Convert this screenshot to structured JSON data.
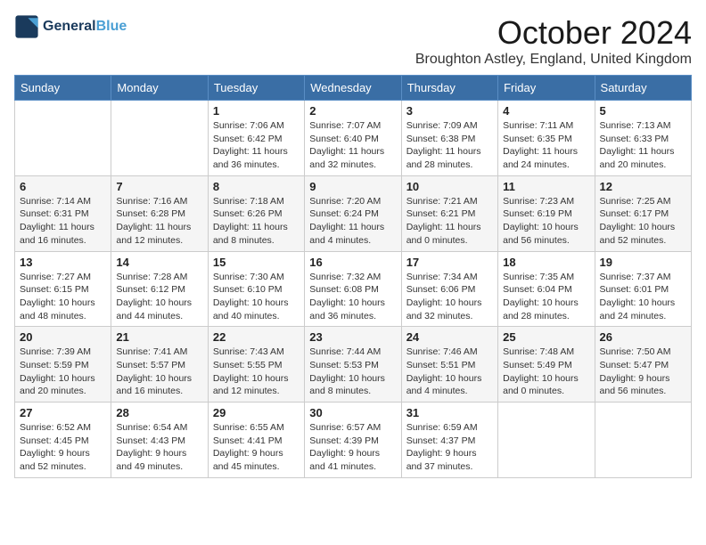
{
  "logo": {
    "line1": "General",
    "line2": "Blue"
  },
  "title": "October 2024",
  "location": "Broughton Astley, England, United Kingdom",
  "days_header": [
    "Sunday",
    "Monday",
    "Tuesday",
    "Wednesday",
    "Thursday",
    "Friday",
    "Saturday"
  ],
  "weeks": [
    [
      {
        "day": "",
        "info": ""
      },
      {
        "day": "",
        "info": ""
      },
      {
        "day": "1",
        "info": "Sunrise: 7:06 AM\nSunset: 6:42 PM\nDaylight: 11 hours and 36 minutes."
      },
      {
        "day": "2",
        "info": "Sunrise: 7:07 AM\nSunset: 6:40 PM\nDaylight: 11 hours and 32 minutes."
      },
      {
        "day": "3",
        "info": "Sunrise: 7:09 AM\nSunset: 6:38 PM\nDaylight: 11 hours and 28 minutes."
      },
      {
        "day": "4",
        "info": "Sunrise: 7:11 AM\nSunset: 6:35 PM\nDaylight: 11 hours and 24 minutes."
      },
      {
        "day": "5",
        "info": "Sunrise: 7:13 AM\nSunset: 6:33 PM\nDaylight: 11 hours and 20 minutes."
      }
    ],
    [
      {
        "day": "6",
        "info": "Sunrise: 7:14 AM\nSunset: 6:31 PM\nDaylight: 11 hours and 16 minutes."
      },
      {
        "day": "7",
        "info": "Sunrise: 7:16 AM\nSunset: 6:28 PM\nDaylight: 11 hours and 12 minutes."
      },
      {
        "day": "8",
        "info": "Sunrise: 7:18 AM\nSunset: 6:26 PM\nDaylight: 11 hours and 8 minutes."
      },
      {
        "day": "9",
        "info": "Sunrise: 7:20 AM\nSunset: 6:24 PM\nDaylight: 11 hours and 4 minutes."
      },
      {
        "day": "10",
        "info": "Sunrise: 7:21 AM\nSunset: 6:21 PM\nDaylight: 11 hours and 0 minutes."
      },
      {
        "day": "11",
        "info": "Sunrise: 7:23 AM\nSunset: 6:19 PM\nDaylight: 10 hours and 56 minutes."
      },
      {
        "day": "12",
        "info": "Sunrise: 7:25 AM\nSunset: 6:17 PM\nDaylight: 10 hours and 52 minutes."
      }
    ],
    [
      {
        "day": "13",
        "info": "Sunrise: 7:27 AM\nSunset: 6:15 PM\nDaylight: 10 hours and 48 minutes."
      },
      {
        "day": "14",
        "info": "Sunrise: 7:28 AM\nSunset: 6:12 PM\nDaylight: 10 hours and 44 minutes."
      },
      {
        "day": "15",
        "info": "Sunrise: 7:30 AM\nSunset: 6:10 PM\nDaylight: 10 hours and 40 minutes."
      },
      {
        "day": "16",
        "info": "Sunrise: 7:32 AM\nSunset: 6:08 PM\nDaylight: 10 hours and 36 minutes."
      },
      {
        "day": "17",
        "info": "Sunrise: 7:34 AM\nSunset: 6:06 PM\nDaylight: 10 hours and 32 minutes."
      },
      {
        "day": "18",
        "info": "Sunrise: 7:35 AM\nSunset: 6:04 PM\nDaylight: 10 hours and 28 minutes."
      },
      {
        "day": "19",
        "info": "Sunrise: 7:37 AM\nSunset: 6:01 PM\nDaylight: 10 hours and 24 minutes."
      }
    ],
    [
      {
        "day": "20",
        "info": "Sunrise: 7:39 AM\nSunset: 5:59 PM\nDaylight: 10 hours and 20 minutes."
      },
      {
        "day": "21",
        "info": "Sunrise: 7:41 AM\nSunset: 5:57 PM\nDaylight: 10 hours and 16 minutes."
      },
      {
        "day": "22",
        "info": "Sunrise: 7:43 AM\nSunset: 5:55 PM\nDaylight: 10 hours and 12 minutes."
      },
      {
        "day": "23",
        "info": "Sunrise: 7:44 AM\nSunset: 5:53 PM\nDaylight: 10 hours and 8 minutes."
      },
      {
        "day": "24",
        "info": "Sunrise: 7:46 AM\nSunset: 5:51 PM\nDaylight: 10 hours and 4 minutes."
      },
      {
        "day": "25",
        "info": "Sunrise: 7:48 AM\nSunset: 5:49 PM\nDaylight: 10 hours and 0 minutes."
      },
      {
        "day": "26",
        "info": "Sunrise: 7:50 AM\nSunset: 5:47 PM\nDaylight: 9 hours and 56 minutes."
      }
    ],
    [
      {
        "day": "27",
        "info": "Sunrise: 6:52 AM\nSunset: 4:45 PM\nDaylight: 9 hours and 52 minutes."
      },
      {
        "day": "28",
        "info": "Sunrise: 6:54 AM\nSunset: 4:43 PM\nDaylight: 9 hours and 49 minutes."
      },
      {
        "day": "29",
        "info": "Sunrise: 6:55 AM\nSunset: 4:41 PM\nDaylight: 9 hours and 45 minutes."
      },
      {
        "day": "30",
        "info": "Sunrise: 6:57 AM\nSunset: 4:39 PM\nDaylight: 9 hours and 41 minutes."
      },
      {
        "day": "31",
        "info": "Sunrise: 6:59 AM\nSunset: 4:37 PM\nDaylight: 9 hours and 37 minutes."
      },
      {
        "day": "",
        "info": ""
      },
      {
        "day": "",
        "info": ""
      }
    ]
  ]
}
